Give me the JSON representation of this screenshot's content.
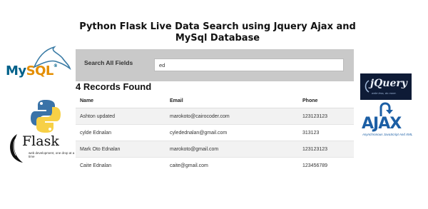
{
  "page": {
    "title": "Python Flask Live Data Search using Jquery Ajax and MySql Database"
  },
  "search": {
    "label": "Search All Fields",
    "value": "ed"
  },
  "results": {
    "count_text": "4 Records Found",
    "columns": [
      "Name",
      "Email",
      "Phone"
    ],
    "rows": [
      {
        "name": "Ashton updated",
        "email": "marokoto@cairocoder.com",
        "phone": "123123123"
      },
      {
        "name": "cylde Ednalan",
        "email": "cyledednalan@gmail.com",
        "phone": "313123"
      },
      {
        "name": "Mark Oto Ednalan",
        "email": "marokoto@gmail.com",
        "phone": "123123123"
      },
      {
        "name": "Caite Ednalan",
        "email": "caite@gmail.com",
        "phone": "123456789"
      }
    ]
  },
  "logos": {
    "mysql": {
      "text_a": "My",
      "text_b": "SQL",
      "reg": "®",
      "colors": {
        "primary": "#00618a",
        "accent": "#e48e00"
      }
    },
    "python": {
      "colors": {
        "blue": "#3a73a8",
        "yellow": "#f7d046"
      }
    },
    "flask": {
      "name": "Flask",
      "tagline": "web development, one drop at a time"
    },
    "jquery": {
      "name": "jQuery",
      "tagline": "write less, do more.",
      "colors": {
        "bg": "#0e1b36"
      }
    },
    "ajax": {
      "name": "AJAX",
      "tagline": "Asynchronous JavaScript And XML",
      "colors": {
        "primary": "#1c5fa5"
      }
    }
  }
}
